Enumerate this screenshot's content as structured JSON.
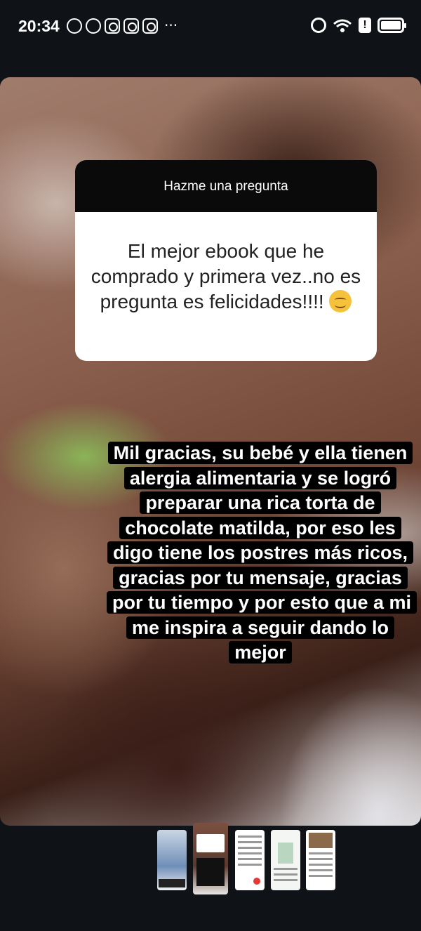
{
  "status_bar": {
    "time": "20:34",
    "notification_icons": [
      "whatsapp-icon",
      "whatsapp-icon",
      "instagram-icon",
      "instagram-icon",
      "instagram-icon"
    ],
    "overflow": "···",
    "system_icons": [
      "alarm-icon",
      "wifi-icon",
      "alert-icon",
      "battery-icon"
    ],
    "alert_glyph": "!"
  },
  "story": {
    "question_sticker": {
      "header": "Hazme una pregunta",
      "question": "El mejor ebook que he comprado y primera vez..no es pregunta es felicidades!!!!",
      "emoji": "smiling-face-emoji"
    },
    "answer_caption": "Mil gracias, su bebé y ella tienen alergia alimentaria y se logró preparar una rica torta de chocolate matilda, por eso les digo tiene los postres más ricos, gracias por tu mensaje, gracias por tu tiempo y por esto que a mi me inspira a seguir dando lo mejor"
  },
  "thumbnails": [
    {
      "name": "story-thumb-1",
      "active": false
    },
    {
      "name": "story-thumb-2",
      "active": true
    },
    {
      "name": "story-thumb-3",
      "active": false
    },
    {
      "name": "story-thumb-4",
      "active": false
    },
    {
      "name": "story-thumb-5",
      "active": false
    }
  ],
  "colors": {
    "background": "#0f1318",
    "sticker_header": "#0a0a0a",
    "sticker_body": "#ffffff",
    "caption_bg": "#000000"
  }
}
